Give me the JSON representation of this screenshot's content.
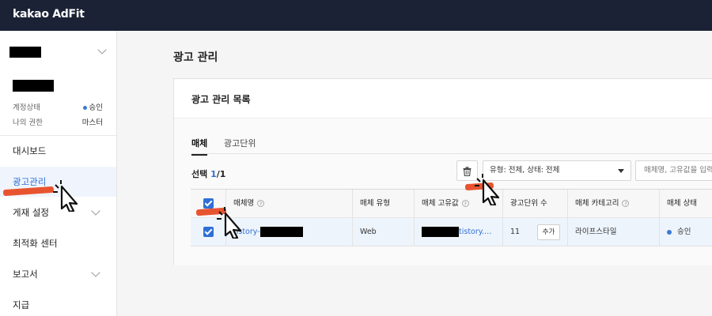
{
  "topbar": {
    "logo": "kakao AdFit"
  },
  "sidebar": {
    "account": {
      "status_label": "계정상태",
      "status_value": "승인",
      "role_label": "나의 권한",
      "role_value": "마스터"
    },
    "items": [
      {
        "label": "대시보드",
        "active": false,
        "has_chevron": false
      },
      {
        "label": "광고관리",
        "active": true,
        "has_chevron": false
      },
      {
        "label": "게재 설정",
        "active": false,
        "has_chevron": true
      },
      {
        "label": "최적화 센터",
        "active": false,
        "has_chevron": false
      },
      {
        "label": "보고서",
        "active": false,
        "has_chevron": true
      },
      {
        "label": "지급",
        "active": false,
        "has_chevron": false
      }
    ]
  },
  "main": {
    "title": "광고 관리",
    "card_title": "광고 관리 목록",
    "tabs": [
      {
        "label": "매체"
      },
      {
        "label": "광고단위"
      }
    ],
    "selection": {
      "prefix": "선택 ",
      "count": "1",
      "total": "/1"
    },
    "filter": {
      "value": "유형: 전체, 상태: 전체"
    },
    "search": {
      "placeholder": "매체명, 고유값을 입력"
    },
    "table": {
      "headers": [
        "매체명",
        "매체 유형",
        "매체 고유값",
        "광고단위 수",
        "매체 카테고리",
        "매체 상태"
      ],
      "rows": [
        {
          "name": "tistory-",
          "type": "Web",
          "unique_value": "tistory.…",
          "ad_units": "11",
          "add_label": "추가",
          "category": "라이프스타일",
          "status": "승인"
        }
      ]
    }
  },
  "colors": {
    "topbar": "#1b2235",
    "accent": "#2f6fd6",
    "annotation": "#e8542f"
  }
}
